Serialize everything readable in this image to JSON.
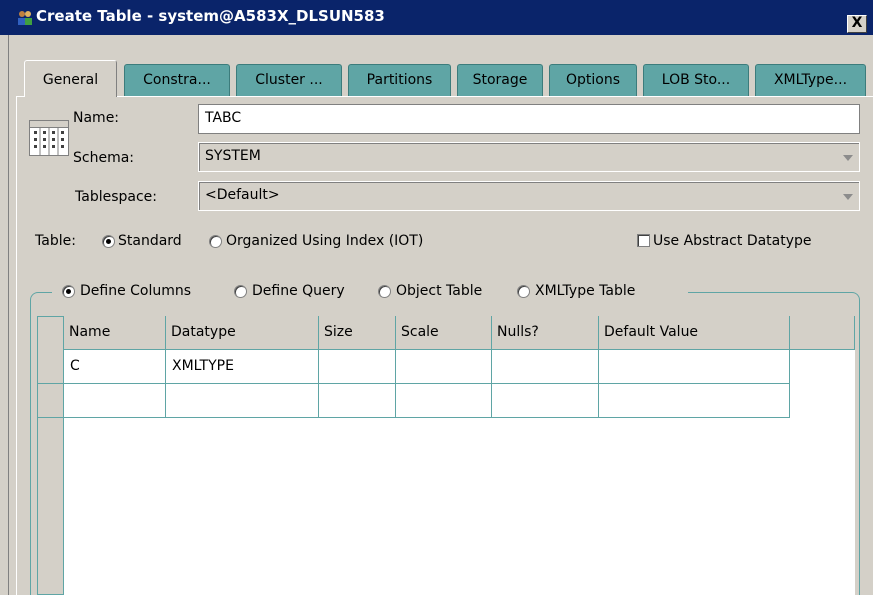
{
  "window": {
    "title": "Create Table - system@A583X_DLSUN583",
    "close_label": "X",
    "app_icon": "people-icon"
  },
  "tabs": [
    {
      "label": "General",
      "active": true
    },
    {
      "label": "Constra..."
    },
    {
      "label": "Cluster ..."
    },
    {
      "label": "Partitions"
    },
    {
      "label": "Storage"
    },
    {
      "label": "Options"
    },
    {
      "label": "LOB Sto..."
    },
    {
      "label": "XMLType..."
    }
  ],
  "general": {
    "name_label": "Name:",
    "name_value": "TABC",
    "schema_label": "Schema:",
    "schema_value": "SYSTEM",
    "tablespace_label": "Tablespace:",
    "tablespace_value": "<Default>",
    "table_label": "Table:",
    "table_type_options": [
      "Standard",
      "Organized Using Index (IOT)"
    ],
    "table_type_selected": "Standard",
    "abstract_datatype_label": "Use Abstract Datatype",
    "abstract_datatype_checked": false,
    "define_options": [
      "Define Columns",
      "Define Query",
      "Object Table",
      "XMLType Table"
    ],
    "define_selected": "Define Columns"
  },
  "columns_table": {
    "headers": [
      "Name",
      "Datatype",
      "Size",
      "Scale",
      "Nulls?",
      "Default Value"
    ],
    "rows": [
      [
        "C",
        "XMLTYPE",
        "",
        "",
        "",
        ""
      ],
      [
        "",
        "",
        "",
        "",
        "",
        ""
      ]
    ]
  },
  "colors": {
    "tab": "#5fa5a5",
    "titlebar": "#0a246a",
    "face": "#d4d0c8"
  }
}
